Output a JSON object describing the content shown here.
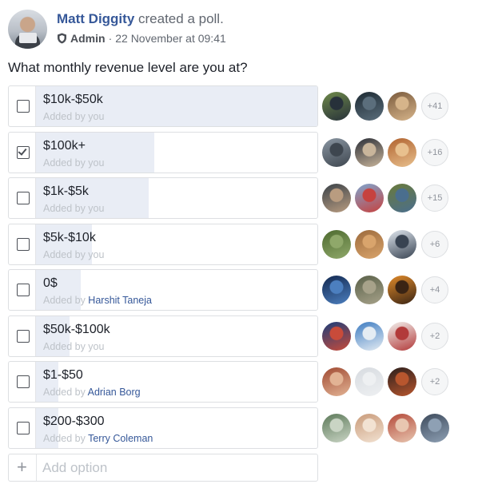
{
  "post": {
    "author": "Matt Diggity",
    "action": "created a poll.",
    "role": "Admin",
    "separator": "·",
    "timestamp": "22 November at 09:41",
    "question": "What monthly revenue level are you at?"
  },
  "options": [
    {
      "label": "$10k-$50k",
      "added_prefix": "Added by ",
      "added_by": "you",
      "checked": false,
      "vote_fraction": 1.0,
      "more_voters": "+41",
      "voter_colors": [
        [
          "#6f8a4a",
          "#27313a"
        ],
        [
          "#1d2a33",
          "#5b6e7c"
        ],
        [
          "#7a5a3c",
          "#d6b48a"
        ]
      ]
    },
    {
      "label": "$100k+",
      "added_prefix": "Added by ",
      "added_by": "you",
      "checked": true,
      "vote_fraction": 0.42,
      "more_voters": "+16",
      "voter_colors": [
        [
          "#8a96a2",
          "#3e464f"
        ],
        [
          "#2b2f38",
          "#c9b59b"
        ],
        [
          "#b0622e",
          "#e8c08e"
        ]
      ]
    },
    {
      "label": "$1k-$5k",
      "added_prefix": "Added by ",
      "added_by": "you",
      "checked": false,
      "vote_fraction": 0.4,
      "more_voters": "+15",
      "voter_colors": [
        [
          "#394148",
          "#b99c80"
        ],
        [
          "#7fa5cf",
          "#c6423f"
        ],
        [
          "#6a7a3a",
          "#4a6e8e"
        ]
      ]
    },
    {
      "label": "$5k-$10k",
      "added_prefix": "Added by ",
      "added_by": "you",
      "checked": false,
      "vote_fraction": 0.2,
      "more_voters": "+6",
      "voter_colors": [
        [
          "#4d6a2f",
          "#8fa86a"
        ],
        [
          "#9c6a3c",
          "#d9a46c"
        ],
        [
          "#dfe6ee",
          "#384352"
        ]
      ]
    },
    {
      "label": "0$",
      "added_prefix": "Added by ",
      "added_by": "Harshit Taneja",
      "checked": false,
      "vote_fraction": 0.16,
      "more_voters": "+4",
      "voter_colors": [
        [
          "#12284f",
          "#4c7fbf"
        ],
        [
          "#596048",
          "#a7a28a"
        ],
        [
          "#e08a2a",
          "#3a2414"
        ]
      ]
    },
    {
      "label": "$50k-$100k",
      "added_prefix": "Added by ",
      "added_by": "you",
      "checked": false,
      "vote_fraction": 0.12,
      "more_voters": "+2",
      "voter_colors": [
        [
          "#1b3d7a",
          "#c84b3a"
        ],
        [
          "#3e7cc1",
          "#e4ecf3"
        ],
        [
          "#f3f1ee",
          "#b23a3a"
        ]
      ]
    },
    {
      "label": "$1-$50",
      "added_prefix": "Added by ",
      "added_by": "Adrian Borg",
      "checked": false,
      "vote_fraction": 0.08,
      "more_voters": "+2",
      "voter_colors": [
        [
          "#a04a32",
          "#e2b394"
        ],
        [
          "#d7dbe0",
          "#eef0f2"
        ],
        [
          "#2a1e1c",
          "#b8562e"
        ]
      ]
    },
    {
      "label": "$200-$300",
      "added_prefix": "Added by ",
      "added_by": "Terry Coleman",
      "checked": false,
      "vote_fraction": 0.08,
      "more_voters": "",
      "voter_colors": [
        [
          "#5d7a5a",
          "#c9d4c4"
        ],
        [
          "#c99b7a",
          "#f2e2d2"
        ],
        [
          "#b44a3a",
          "#e8c6b0"
        ],
        [
          "#3d4a5c",
          "#8ea0b4"
        ]
      ]
    }
  ],
  "add_option": {
    "icon": "plus-icon",
    "placeholder": "Add option"
  },
  "colors": {
    "link": "#365899",
    "bar": "#e9edf5",
    "border": "#dddfe2",
    "muted": "#bec3c9"
  }
}
